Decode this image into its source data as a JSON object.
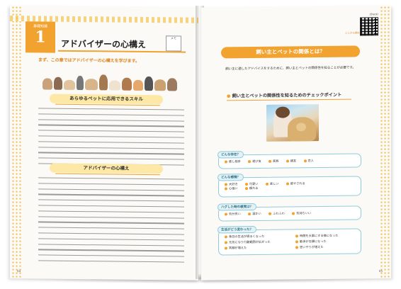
{
  "left_page": {
    "chapter_tag": "基礎知識",
    "chapter_number": "1",
    "title": "アドバイザーの心構え",
    "memo_label": "メモ",
    "lead": "まず、この章ではアドバイザーの心構えを学びます。",
    "section1_heading": "あらゆるペットに応用できるスキル",
    "section2_heading": "アドバイザーの心構え",
    "page_number": "04"
  },
  "right_page": {
    "qr_label": "Check!",
    "qr_note": "ここから読む",
    "banner": "飼い主とペットの関係とは？",
    "intro": "飼い主に適したアドバイスをするために、飼い主とペットの関係性を知ることが必要です。",
    "checklist_title": "飼い主とペットの関係性を知るためのチェックポイント",
    "boxes": [
      {
        "label": "どんな存在？",
        "options": [
          "癒し相手",
          "遊び友",
          "家族",
          "親友",
          "恋人"
        ]
      },
      {
        "label": "どんな感情？",
        "options": [
          "大好き",
          "可愛い",
          "楽しい",
          "癒やされる",
          "心強い",
          "頼れる"
        ]
      },
      {
        "label": "ハグした時の感覚は？",
        "options": [
          "気分良い",
          "温かい",
          "ふわふわ",
          "気持ちいい"
        ]
      },
      {
        "label": "生活がどう変わった？",
        "options_left": [
          "毎日の生活が明るくなった",
          "元気になり行動範囲が広がった",
          "笑顔が増えた"
        ],
        "options_right": [
          "時間を大事にする様になった",
          "散歩が日課になった",
          "思いやりが増えた"
        ]
      }
    ],
    "page_number": "05"
  },
  "colors": {
    "accent": "#f2a22e",
    "box_border": "#8fcbdc",
    "paper": "#fbfaf6"
  }
}
